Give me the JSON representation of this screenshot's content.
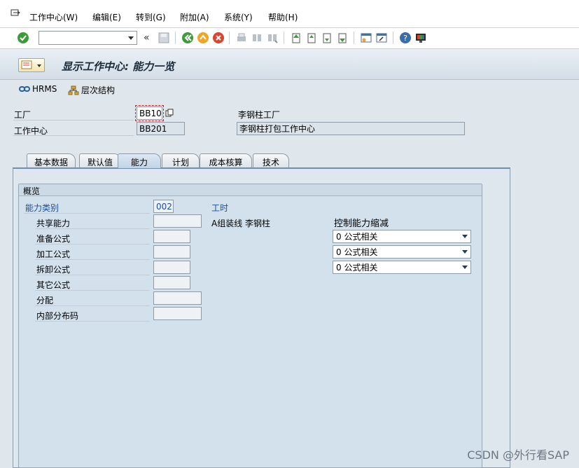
{
  "menu": {
    "items": [
      "工作中心(W)",
      "编辑(E)",
      "转到(G)",
      "附加(A)",
      "系统(Y)",
      "帮助(H)"
    ]
  },
  "toolbar": {
    "command_value": "",
    "icons": [
      "enter-icon",
      "back-icon",
      "save-icon",
      "green-back-icon",
      "exit-icon",
      "cancel-icon",
      "print-icon",
      "find-icon",
      "find-next-icon",
      "first-page-icon",
      "prev-page-icon",
      "next-page-icon",
      "last-page-icon",
      "new-session-icon",
      "shortcut-icon",
      "help-icon",
      "customize-layout-icon"
    ]
  },
  "title": {
    "text": "显示工作中心: 能力一览"
  },
  "app_toolbar": {
    "hrms_label": "HRMS",
    "hierarchy_label": "层次结构"
  },
  "header": {
    "plant_label": "工厂",
    "plant_value": "BB10",
    "plant_desc": "李钢柱工厂",
    "workcenter_label": "工作中心",
    "workcenter_value": "BB201",
    "workcenter_desc": "李钢柱打包工作中心"
  },
  "tabs": [
    {
      "label": "基本数据",
      "active": false
    },
    {
      "label": "默认值",
      "active": false
    },
    {
      "label": "能力",
      "active": true
    },
    {
      "label": "计划",
      "active": false
    },
    {
      "label": "成本核算",
      "active": false
    },
    {
      "label": "技术",
      "active": false
    }
  ],
  "overview": {
    "group_title": "概览",
    "capacity_category_label": "能力类别",
    "capacity_category_value": "002",
    "capacity_unit_label": "工时",
    "capacity_desc": "A组装线 李钢柱",
    "rows": [
      {
        "label": "共享能力",
        "value": ""
      },
      {
        "label": "准备公式",
        "value": ""
      },
      {
        "label": "加工公式",
        "value": ""
      },
      {
        "label": "拆卸公式",
        "value": ""
      },
      {
        "label": "其它公式",
        "value": ""
      },
      {
        "label": "分配",
        "value": ""
      },
      {
        "label": "内部分布码",
        "value": ""
      }
    ],
    "reduction_title": "控制能力缩减",
    "reductions": [
      "0 公式相关",
      "0 公式相关",
      "0 公式相关"
    ]
  },
  "watermark": "CSDN @外行看SAP",
  "colors": {
    "blue_label": "#1a4fa0",
    "focus": "#dd2222"
  }
}
